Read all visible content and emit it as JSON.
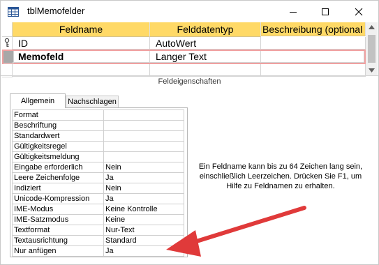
{
  "window": {
    "title": "tblMemofelder",
    "icon": "table-icon"
  },
  "grid": {
    "columns": [
      "Feldname",
      "Felddatentyp",
      "Beschreibung (optional"
    ],
    "rows": [
      {
        "name": "ID",
        "type": "AutoWert",
        "description": "",
        "primary_key": true
      },
      {
        "name": "Memofeld",
        "type": "Langer Text",
        "description": "",
        "selected": true
      },
      {
        "name": "",
        "type": "",
        "description": ""
      }
    ]
  },
  "properties": {
    "section_title": "Feldeigenschaften",
    "tabs": [
      "Allgemein",
      "Nachschlagen"
    ],
    "active_tab": "Allgemein",
    "rows": [
      {
        "label": "Format",
        "value": ""
      },
      {
        "label": "Beschriftung",
        "value": ""
      },
      {
        "label": "Standardwert",
        "value": ""
      },
      {
        "label": "Gültigkeitsregel",
        "value": ""
      },
      {
        "label": "Gültigkeitsmeldung",
        "value": ""
      },
      {
        "label": "Eingabe erforderlich",
        "value": "Nein"
      },
      {
        "label": "Leere Zeichenfolge",
        "value": "Ja"
      },
      {
        "label": "Indiziert",
        "value": "Nein"
      },
      {
        "label": "Unicode-Kompression",
        "value": "Ja"
      },
      {
        "label": "IME-Modus",
        "value": "Keine Kontrolle"
      },
      {
        "label": "IME-Satzmodus",
        "value": "Keine"
      },
      {
        "label": "Textformat",
        "value": "Nur-Text"
      },
      {
        "label": "Textausrichtung",
        "value": "Standard"
      },
      {
        "label": "Nur anfügen",
        "value": "Ja"
      }
    ],
    "help_text": "Ein Feldname kann bis zu 64 Zeichen lang sein, einschließlich Leerzeichen. Drücken Sie F1, um Hilfe zu Feldnamen zu erhalten."
  },
  "colors": {
    "header": "#ffd966",
    "selected_row_border": "#f0a0a0",
    "arrow": "#e03a3a"
  }
}
